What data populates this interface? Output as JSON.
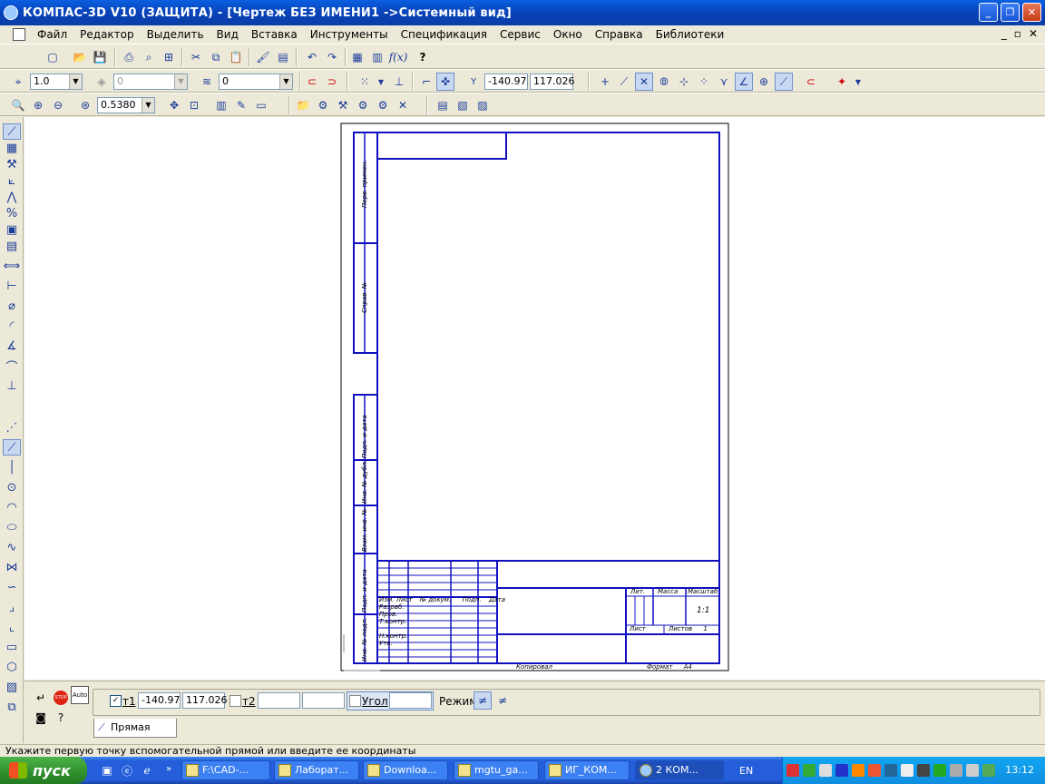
{
  "window": {
    "title": "КОМПАС-3D V10 (ЗАЩИТА) - [Чертеж БЕЗ ИМЕНИ1 ->Системный вид]",
    "minimize": "_",
    "maximize": "❐",
    "close": "✕"
  },
  "menu": {
    "items": [
      "Файл",
      "Редактор",
      "Выделить",
      "Вид",
      "Вставка",
      "Инструменты",
      "Спецификация",
      "Сервис",
      "Окно",
      "Справка",
      "Библиотеки"
    ],
    "right_controls": [
      "_",
      "▫",
      "✕"
    ]
  },
  "toolbar1": {
    "icons": [
      "new-icon",
      "open-icon",
      "save-icon",
      "print-icon",
      "preview-icon",
      "cut-icon",
      "copy-icon",
      "paste-icon",
      "undo-icon",
      "redo-icon",
      "fx-icon",
      "help-icon"
    ],
    "fx_label": "f(x)"
  },
  "toolbar2": {
    "line_scale": "1.0",
    "layer_state": "0",
    "layer": "0",
    "coord_x_label": "Y",
    "coord_x": "-140.97",
    "coord_y": "117.026"
  },
  "toolbar3": {
    "zoom": "0.5380"
  },
  "properties": {
    "t1_label": "т1",
    "t1_x": "-140.97",
    "t1_y": "117.026",
    "t2_label": "т2",
    "t2_x": "",
    "t2_y": "",
    "angle_label": "Угол",
    "angle_value": "",
    "mode_label": "Режим",
    "tab_label": "Прямая",
    "auto_label": "Auto",
    "stop_label": "STOP"
  },
  "status": {
    "hint": "Укажите первую точку вспомогательной прямой или введите ее координаты"
  },
  "drawing": {
    "format_label": "Формат",
    "format_value": "А4",
    "copy_label": "Копировал",
    "lit_label": "Лит.",
    "mass_label": "Масса",
    "scale_label": "Масштаб",
    "scale_value": "1:1",
    "sheet_label": "Лист",
    "sheets_label": "Листов",
    "sheets_value": "1",
    "rows": [
      "Изм.",
      "Лист",
      "№ докум.",
      "Подп.",
      "Дата"
    ],
    "signers": [
      "Разраб.",
      "Пров.",
      "Т.контр.",
      "Н.контр.",
      "Утв."
    ],
    "margin_labels": [
      "Перв. примен.",
      "Справ. №",
      "Подп. и дата",
      "Инв. № дубл.",
      "Взам. инв. №",
      "Подп. и дата",
      "Инв. № подл."
    ]
  },
  "taskbar": {
    "start": "пуск",
    "tasks": [
      "F:\\CAD-...",
      "Лаборат...",
      "Downloa...",
      "mgtu_ga...",
      "ИГ_КОМ...",
      "2 КОМ..."
    ],
    "lang": "EN",
    "clock": "13:12"
  }
}
